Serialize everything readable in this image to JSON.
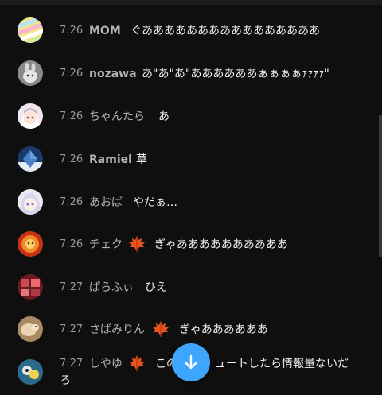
{
  "messages": [
    {
      "time": "7:26",
      "author": "MOM",
      "text": "ぐああああああああああああああああ"
    },
    {
      "time": "7:26",
      "author": "nozawa",
      "text": "あ\"あ\"あ\"ああああああぁぁぁぁｧｧｧｧ\""
    },
    {
      "time": "7:26",
      "author": "ちゃんたら",
      "text": "あ"
    },
    {
      "time": "7:26",
      "author": "Ramiel",
      "text": "草"
    },
    {
      "time": "7:26",
      "author": "あおば",
      "text": "やだぁ…"
    },
    {
      "time": "7:26",
      "author": "チェク",
      "text": "ぎゃああああああああああ"
    },
    {
      "time": "7:27",
      "author": "ぱらふぃ",
      "text": "ひえ"
    },
    {
      "time": "7:27",
      "author": "さばみりん",
      "text": "ぎゃああああああ"
    },
    {
      "time": "7:27",
      "author": "しやゆ",
      "text_before": "この",
      "text_after": "ュートしたら情報量ないだ",
      "text_wrap": "ろ"
    }
  ],
  "badge_icon": "maple-leaf-icon",
  "scroll_button_icon": "arrow-down-icon",
  "colors": {
    "background": "#0f0f0f",
    "timestamp": "#9a9a9a",
    "author": "#b4b4b4",
    "message": "#f1f1f1",
    "accent": "#3ea6ff",
    "badge": "#e8541e"
  }
}
